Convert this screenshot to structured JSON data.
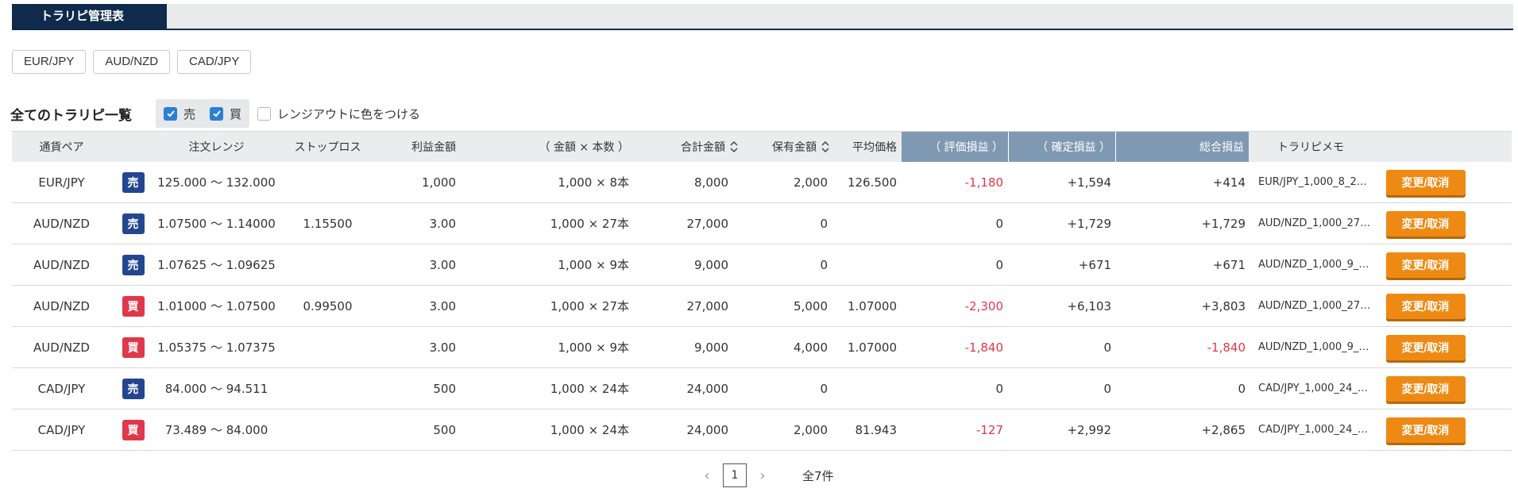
{
  "tab": {
    "title": "トラリピ管理表"
  },
  "pairs": [
    "EUR/JPY",
    "AUD/NZD",
    "CAD/JPY"
  ],
  "list": {
    "title": "全てのトラリピ一覧",
    "filter_sell": "売",
    "filter_buy": "買",
    "range_out_label": "レンジアウトに色をつける"
  },
  "columns": {
    "pair": "通貨ペア",
    "range": "注文レンジ",
    "stoploss": "ストップロス",
    "profit": "利益金額",
    "qty": "（ 金額 × 本数 ）",
    "total": "合計金額",
    "holding": "保有金額",
    "avg": "平均価格",
    "unrealized": "（ 評価損益 ）",
    "realized": "（ 確定損益 ）",
    "overall": "総合損益",
    "memo": "トラリピメモ"
  },
  "rows": [
    {
      "pair": "EUR/JPY",
      "side": "売",
      "side_type": "sell",
      "range": "125.000 〜 132.000",
      "stoploss": "",
      "profit": "1,000",
      "qty": "1,000 × 8本",
      "total": "8,000",
      "holding": "2,000",
      "avg": "126.500",
      "unrealized": "-1,180",
      "realized": "+1,594",
      "overall": "+414",
      "memo": "EUR/JPY_1,000_8_2…",
      "action": "変更/取消"
    },
    {
      "pair": "AUD/NZD",
      "side": "売",
      "side_type": "sell",
      "range": "1.07500 〜 1.14000",
      "stoploss": "1.15500",
      "profit": "3.00",
      "qty": "1,000 × 27本",
      "total": "27,000",
      "holding": "0",
      "avg": "",
      "unrealized": "0",
      "realized": "+1,729",
      "overall": "+1,729",
      "memo": "AUD/NZD_1,000_27…",
      "action": "変更/取消"
    },
    {
      "pair": "AUD/NZD",
      "side": "売",
      "side_type": "sell",
      "range": "1.07625 〜 1.09625",
      "stoploss": "",
      "profit": "3.00",
      "qty": "1,000 × 9本",
      "total": "9,000",
      "holding": "0",
      "avg": "",
      "unrealized": "0",
      "realized": "+671",
      "overall": "+671",
      "memo": "AUD/NZD_1,000_9_…",
      "action": "変更/取消"
    },
    {
      "pair": "AUD/NZD",
      "side": "買",
      "side_type": "buy",
      "range": "1.01000 〜 1.07500",
      "stoploss": "0.99500",
      "profit": "3.00",
      "qty": "1,000 × 27本",
      "total": "27,000",
      "holding": "5,000",
      "avg": "1.07000",
      "unrealized": "-2,300",
      "realized": "+6,103",
      "overall": "+3,803",
      "memo": "AUD/NZD_1,000_27…",
      "action": "変更/取消"
    },
    {
      "pair": "AUD/NZD",
      "side": "買",
      "side_type": "buy",
      "range": "1.05375 〜 1.07375",
      "stoploss": "",
      "profit": "3.00",
      "qty": "1,000 × 9本",
      "total": "9,000",
      "holding": "4,000",
      "avg": "1.07000",
      "unrealized": "-1,840",
      "realized": "0",
      "overall": "-1,840",
      "memo": "AUD/NZD_1,000_9_…",
      "action": "変更/取消"
    },
    {
      "pair": "CAD/JPY",
      "side": "売",
      "side_type": "sell",
      "range": "84.000 〜 94.511",
      "stoploss": "",
      "profit": "500",
      "qty": "1,000 × 24本",
      "total": "24,000",
      "holding": "0",
      "avg": "",
      "unrealized": "0",
      "realized": "0",
      "overall": "0",
      "memo": "CAD/JPY_1,000_24_…",
      "action": "変更/取消"
    },
    {
      "pair": "CAD/JPY",
      "side": "買",
      "side_type": "buy",
      "range": "73.489 〜 84.000",
      "stoploss": "",
      "profit": "500",
      "qty": "1,000 × 24本",
      "total": "24,000",
      "holding": "2,000",
      "avg": "81.943",
      "unrealized": "-127",
      "realized": "+2,992",
      "overall": "+2,865",
      "memo": "CAD/JPY_1,000_24_…",
      "action": "変更/取消"
    }
  ],
  "pagination": {
    "prev": "‹",
    "page": "1",
    "next": "›",
    "total": "全7件"
  },
  "colors": {
    "navy": "#102a4c",
    "sell": "#24468f",
    "buy": "#e0384b",
    "negative": "#e0384b",
    "action": "#ee8a14",
    "header_highlight": "#8099b3"
  }
}
